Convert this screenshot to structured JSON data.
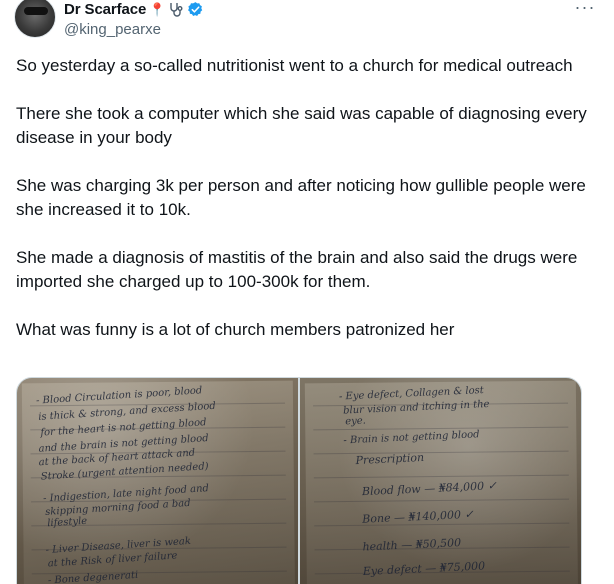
{
  "author": {
    "display_name": "Dr Scarface",
    "handle": "@king_pearxe",
    "badge_icons": [
      "pin-icon",
      "stethoscope-icon",
      "verified-icon"
    ],
    "verified_color": "#1d9bf0"
  },
  "more_icon": "···",
  "tweet": {
    "paragraphs": [
      "So yesterday a so-called nutritionist went to a church for medical outreach",
      "There she took a computer which she said was capable of diagnosing every disease in your body",
      "She was charging 3k per person and after noticing how gullible people were she increased it to 10k.",
      "She made a diagnosis of mastitis of the brain and also said the drugs were imported she charged up to 100-300k for them.",
      "What was funny is a lot of church members patronized her"
    ]
  },
  "media": {
    "left_note": [
      "- Blood Circulation is poor, blood",
      "is thick & strong, and excess blood",
      "for the heart is not getting blood",
      "and the brain is not getting blood",
      "at the back of heart attack and",
      "Stroke (urgent attention needed)",
      "- Indigestion, late night food and",
      "skipping morning food a bad",
      "lifestyle",
      "- Liver Disease, liver is weak",
      "at the Risk of liver failure",
      "- Bone degenerati"
    ],
    "right_note": [
      "- Eye defect, Collagen & lost",
      "blur vision and itching in the",
      "eye.",
      "- Brain is not getting blood",
      "Prescription",
      "Blood flow — ₦84,000 ✓",
      "Bone — ₦140,000 ✓",
      "health — ₦50,500",
      "Eye defect — ₦75,000"
    ]
  }
}
